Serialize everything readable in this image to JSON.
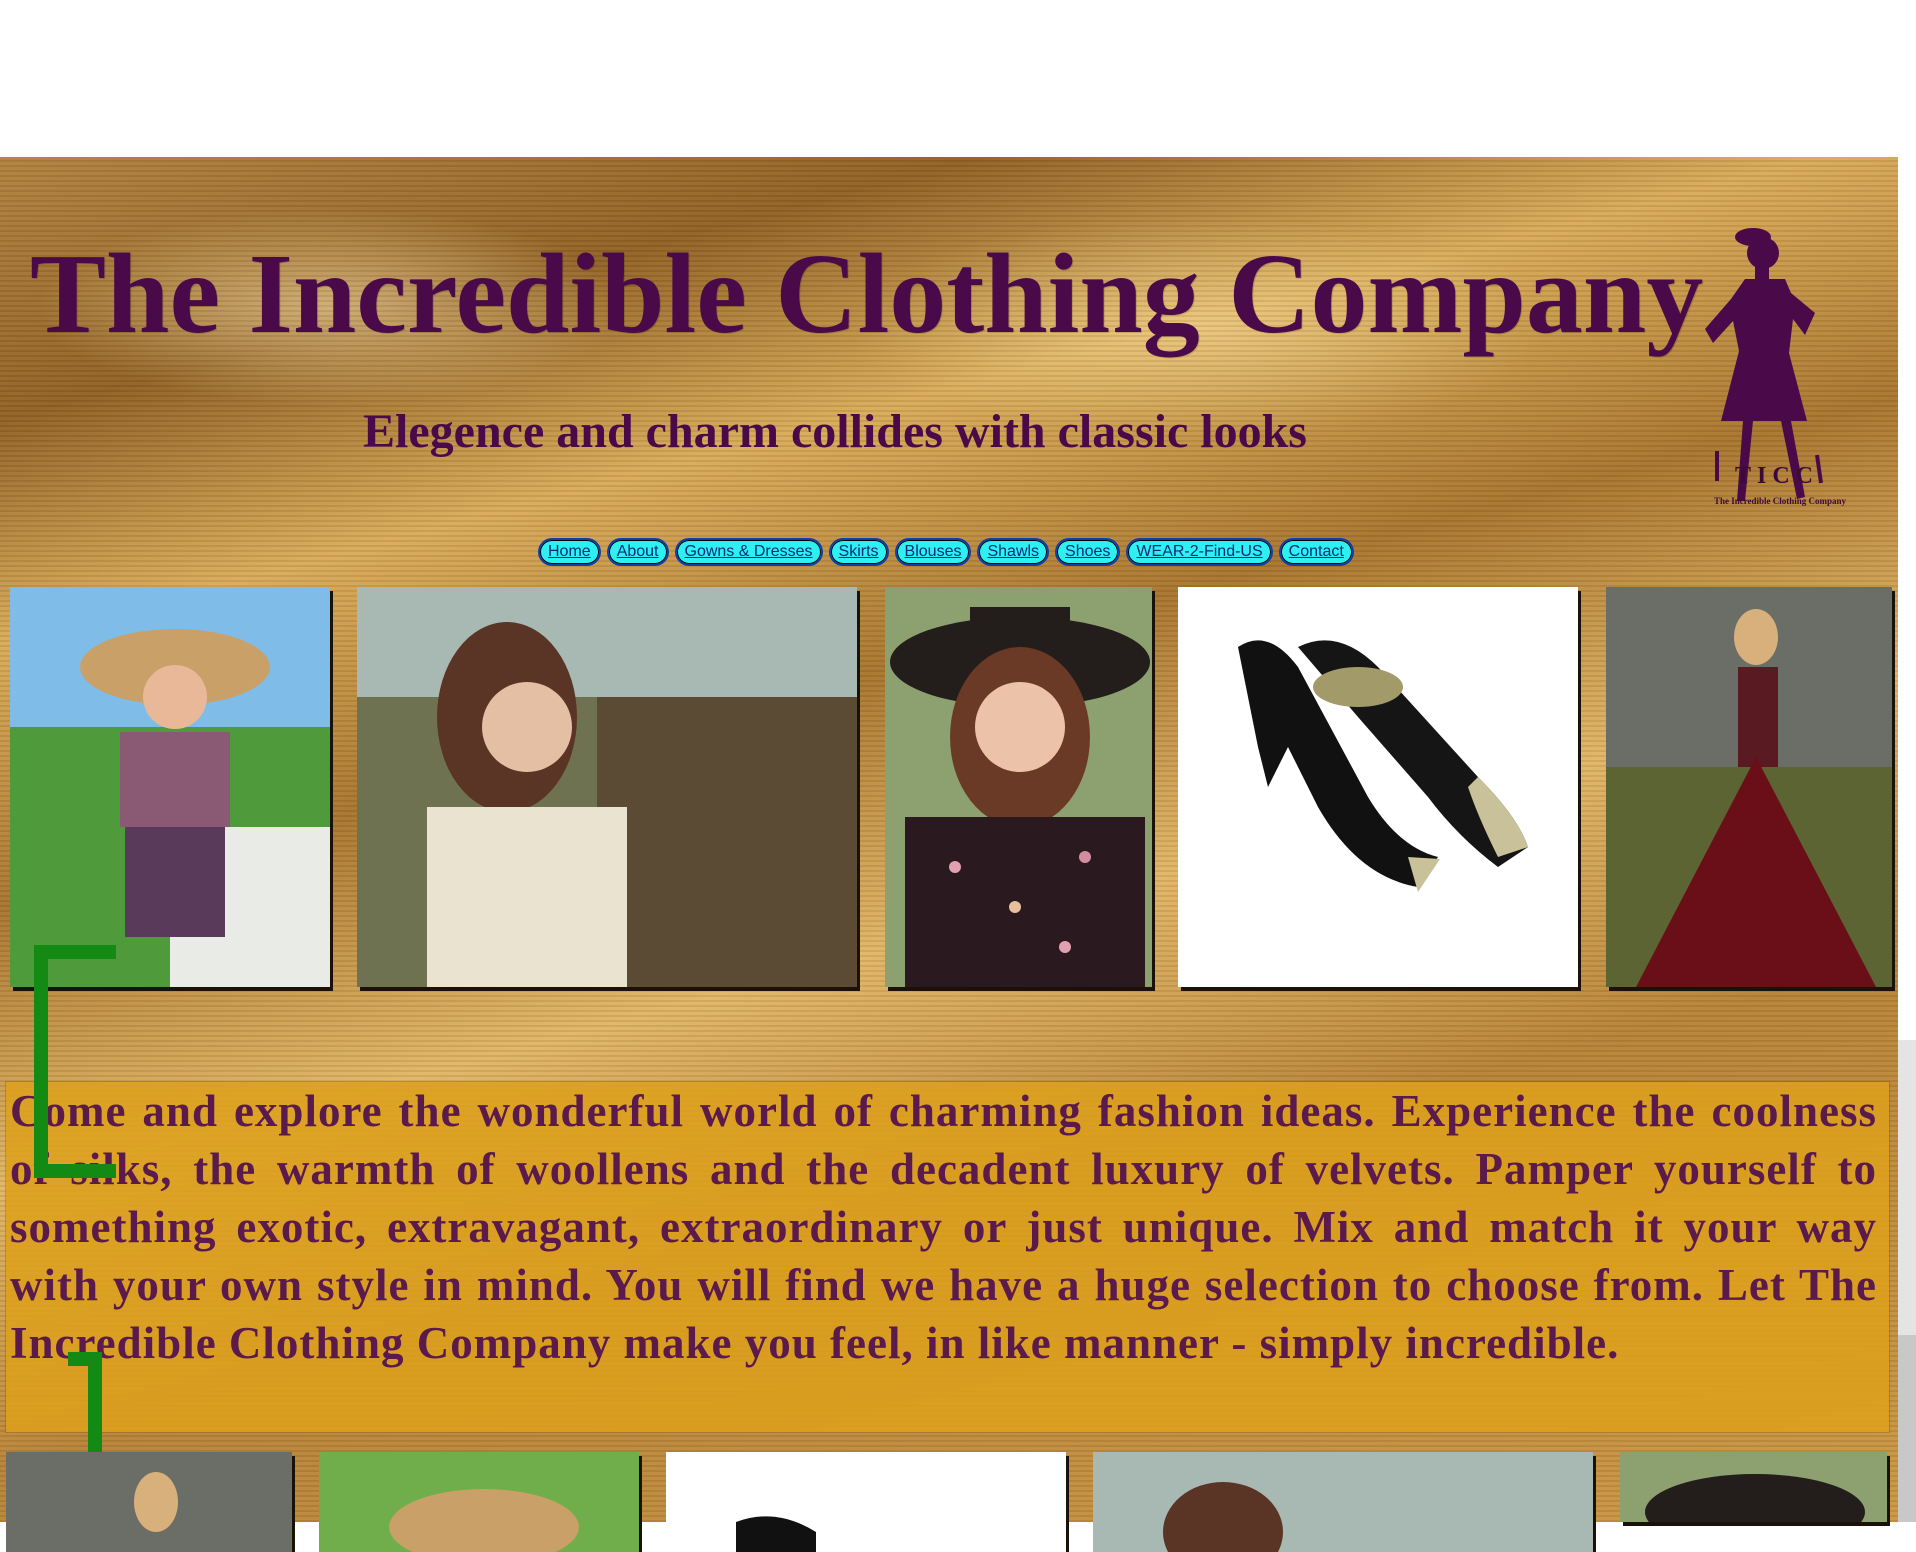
{
  "header": {
    "title": "The Incredible Clothing Company",
    "tagline": "Elegence and charm collides with classic looks",
    "logo": {
      "initials": "TICC",
      "caption": "The Incredible Clothing Company"
    }
  },
  "nav": {
    "items": [
      {
        "label": "Home"
      },
      {
        "label": "About"
      },
      {
        "label": "Gowns & Dresses"
      },
      {
        "label": "Skirts"
      },
      {
        "label": "Blouses"
      },
      {
        "label": "Shawls"
      },
      {
        "label": "Shoes"
      },
      {
        "label": "WEAR-2-Find-US"
      },
      {
        "label": "Contact"
      }
    ]
  },
  "main": {
    "intro": "Come and explore the wonderful world of charming fashion ideas. Experience the coolness of silks, the warmth of woollens and the decadent luxury of velvets. Pamper yourself to something exotic, extravagant, extraordinary or just unique. Mix and match it your way with your own style in mind. You will find we have a huge selection to choose from. Let The Incredible Clothing Company make you feel, in like manner - simply incredible."
  },
  "colors": {
    "title": "#4a0a4a",
    "nav_bg": "#2ef0f0",
    "nav_border": "#123ea8",
    "intro_bg": "#dda01c",
    "intro_text": "#5a1a4c",
    "bracket": "#138a13"
  }
}
